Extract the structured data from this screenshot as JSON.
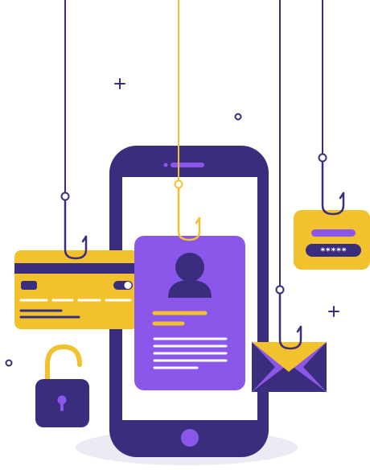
{
  "password_card": {
    "masked_password": "*****"
  },
  "colors": {
    "navy": "#3a2d7d",
    "purple": "#8b57ea",
    "yellow": "#f2c12e",
    "white": "#ffffff",
    "shadow": "#ecebf4"
  },
  "icons": {
    "phone": "smartphone-icon",
    "profile": "id-card-profile-icon",
    "credit_card": "credit-card-icon",
    "envelope": "email-envelope-icon",
    "password": "password-field-icon",
    "padlock": "open-padlock-icon",
    "hook": "fishing-hook-icon"
  }
}
